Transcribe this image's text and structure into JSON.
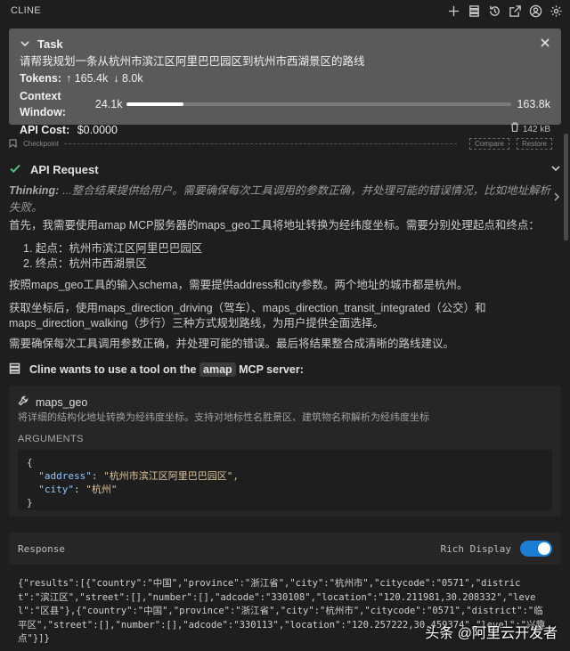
{
  "app": {
    "title": "CLINE"
  },
  "toolbar": {
    "icons": [
      "plus-icon",
      "database-icon",
      "history-icon",
      "external-link-icon",
      "account-icon",
      "gear-icon"
    ]
  },
  "task": {
    "header": "Task",
    "description": "请帮我规划一条从杭州市滨江区阿里巴巴园区到杭州市西湖景区的路线",
    "tokens_label": "Tokens:",
    "tokens_in": "↑ 165.4k",
    "tokens_out": "↓ 8.0k",
    "context_label": "Context Window:",
    "context_used": "24.1k",
    "context_max": "163.8k",
    "context_fraction": 0.147,
    "api_cost_label": "API Cost:",
    "api_cost": "$0.0000",
    "size": "142 kB"
  },
  "checkpoint": {
    "label": "Checkpoint",
    "compare": "Compare",
    "restore": "Restore"
  },
  "api_request": {
    "label": "API Request"
  },
  "thinking": {
    "label": "Thinking:",
    "text": "...整合结果提供给用户。需要确保每次工具调用的参数正确，并处理可能的错误情况，比如地址解析失败。"
  },
  "message": {
    "p1": "首先，我需要使用amap MCP服务器的maps_geo工具将地址转换为经纬度坐标。需要分别处理起点和终点：",
    "item1": "1. 起点：杭州市滨江区阿里巴巴园区",
    "item2": "2. 终点：杭州市西湖景区",
    "p2": "按照maps_geo工具的输入schema，需要提供address和city参数。两个地址的城市都是杭州。",
    "p3a": "获取坐标后，使用maps_direction_driving（驾车）、maps_direction_transit_integrated（公交）和",
    "p3b": "maps_direction_walking（步行）三种方式规划路线，为用户提供全面选择。",
    "p4": "需要确保每次工具调用参数正确，并处理可能的错误。最后将结果整合成清晰的路线建议。"
  },
  "tool_use": {
    "prefix": "Cline wants to use a tool on the",
    "server": "amap",
    "suffix": "MCP server:",
    "tool_name": "maps_geo",
    "tool_desc": "将详细的结构化地址转换为经纬度坐标。支持对地标性名胜景区、建筑物名称解析为经纬度坐标",
    "arguments_label": "ARGUMENTS",
    "arg_open": "{",
    "arg_key1": "\"address\"",
    "arg_val1": "\"杭州市滨江区阿里巴巴园区\",",
    "arg_key2": "\"city\"",
    "arg_val2": "\"杭州\"",
    "arg_close": "}"
  },
  "response": {
    "label": "Response",
    "rich_display": "Rich Display",
    "rich_display_on": true,
    "body": "{\"results\":[{\"country\":\"中国\",\"province\":\"浙江省\",\"city\":\"杭州市\",\"citycode\":\"0571\",\"district\":\"滨江区\",\"street\":[],\"number\":[],\"adcode\":\"330108\",\"location\":\"120.211981,30.208332\",\"level\":\"区县\"},{\"country\":\"中国\",\"province\":\"浙江省\",\"city\":\"杭州市\",\"citycode\":\"0571\",\"district\":\"临平区\",\"street\":[],\"number\":[],\"adcode\":\"330113\",\"location\":\"120.257222,30.459374\",\"level\":\"兴趣点\"}]}"
  },
  "watermark": "头条 @阿里云开发者"
}
